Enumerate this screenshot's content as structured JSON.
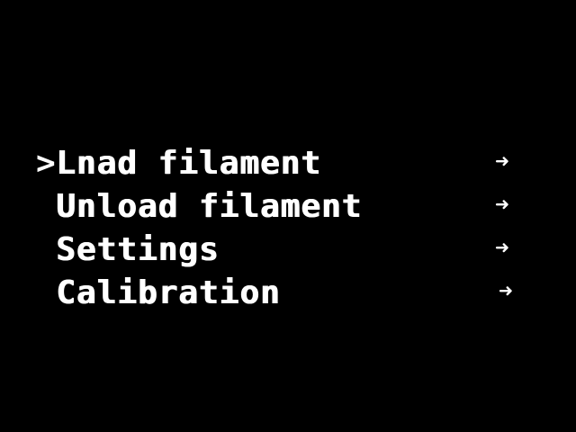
{
  "colors": {
    "background": "#000000",
    "foreground": "#ffffff"
  },
  "menu": {
    "cursor": ">",
    "items": [
      {
        "label": "Lnad filament",
        "arrow": "➜",
        "arrow_icon": "arrow-right-icon",
        "selected": true
      },
      {
        "label": "Unload filament",
        "arrow": "➜",
        "arrow_icon": "arrow-right-icon",
        "selected": false
      },
      {
        "label": "Settings",
        "arrow": "➜",
        "arrow_icon": "arrow-right-icon",
        "selected": false
      },
      {
        "label": "Calibration",
        "arrow": "➜",
        "arrow_icon": "arrow-right-icon",
        "selected": false
      }
    ]
  }
}
